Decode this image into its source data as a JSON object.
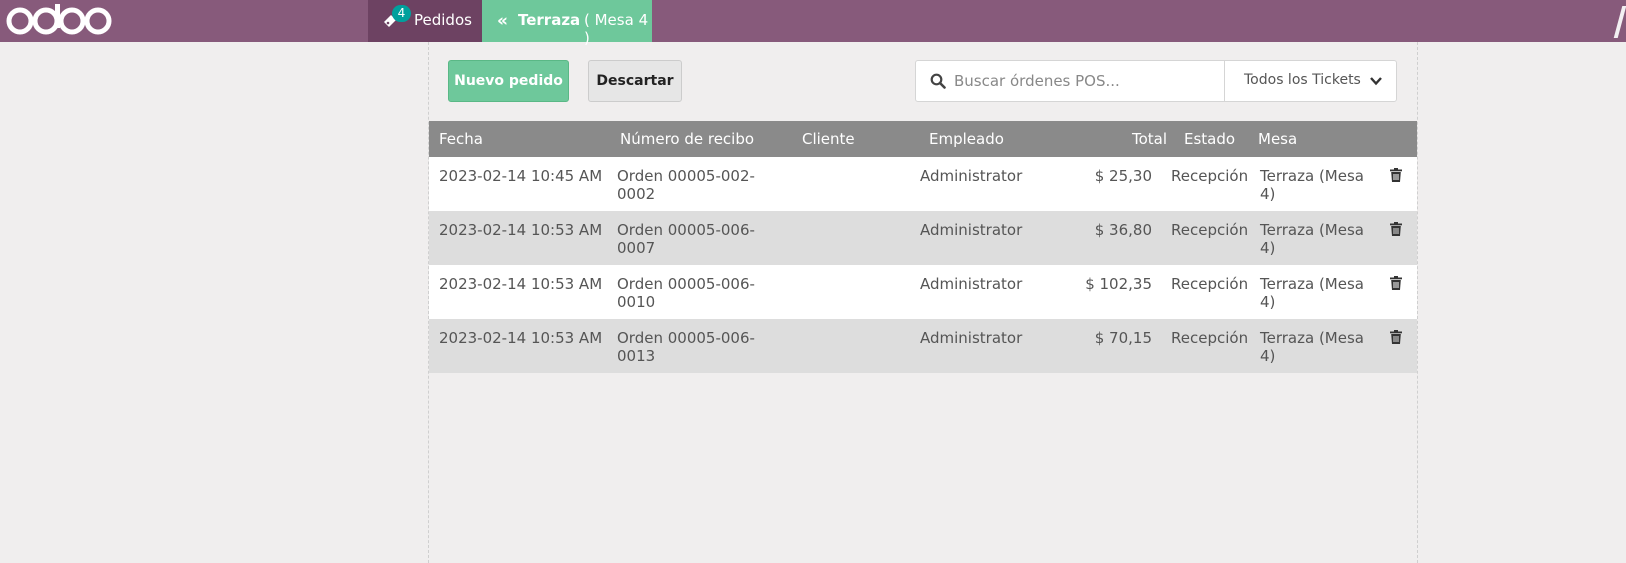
{
  "brand": {
    "logo_text": "odoo"
  },
  "topbar": {
    "orders_tab": {
      "label": "Pedidos",
      "badge": "4",
      "icon": "ticket-icon"
    },
    "table_tab": {
      "name": "Terraza",
      "sub": "( Mesa 4 )",
      "icon": "double-chevron-left-icon"
    }
  },
  "actions": {
    "new_order_label": "Nuevo pedido",
    "discard_label": "Descartar"
  },
  "search": {
    "placeholder": "Buscar órdenes POS...",
    "filter_value": "Todos los Tickets"
  },
  "table": {
    "columns": {
      "date": "Fecha",
      "receipt": "Número de recibo",
      "customer": "Cliente",
      "employee": "Empleado",
      "total": "Total",
      "state": "Estado",
      "table": "Mesa"
    },
    "rows": [
      {
        "date": "2023-02-14 10:45 AM",
        "receipt_1": "Orden 00005-002-",
        "receipt_2": "0002",
        "customer": "",
        "employee": "Administrator",
        "total": "$ 25,30",
        "state": "Recepción",
        "table_1": "Terraza (Mesa",
        "table_2": "4)"
      },
      {
        "date": "2023-02-14 10:53 AM",
        "receipt_1": "Orden 00005-006-",
        "receipt_2": "0007",
        "customer": "",
        "employee": "Administrator",
        "total": "$ 36,80",
        "state": "Recepción",
        "table_1": "Terraza (Mesa",
        "table_2": "4)"
      },
      {
        "date": "2023-02-14 10:53 AM",
        "receipt_1": "Orden 00005-006-",
        "receipt_2": "0010",
        "customer": "",
        "employee": "Administrator",
        "total": "$ 102,35",
        "state": "Recepción",
        "table_1": "Terraza (Mesa",
        "table_2": "4)"
      },
      {
        "date": "2023-02-14 10:53 AM",
        "receipt_1": "Orden 00005-006-",
        "receipt_2": "0013",
        "customer": "",
        "employee": "Administrator",
        "total": "$ 70,15",
        "state": "Recepción",
        "table_1": "Terraza (Mesa",
        "table_2": "4)"
      }
    ]
  },
  "colors": {
    "topbar": "#875a7b",
    "active_tab": "#6d4262",
    "accent_green": "#6ec89b",
    "badge": "#00a09d",
    "table_header": "#8a8a8a"
  }
}
